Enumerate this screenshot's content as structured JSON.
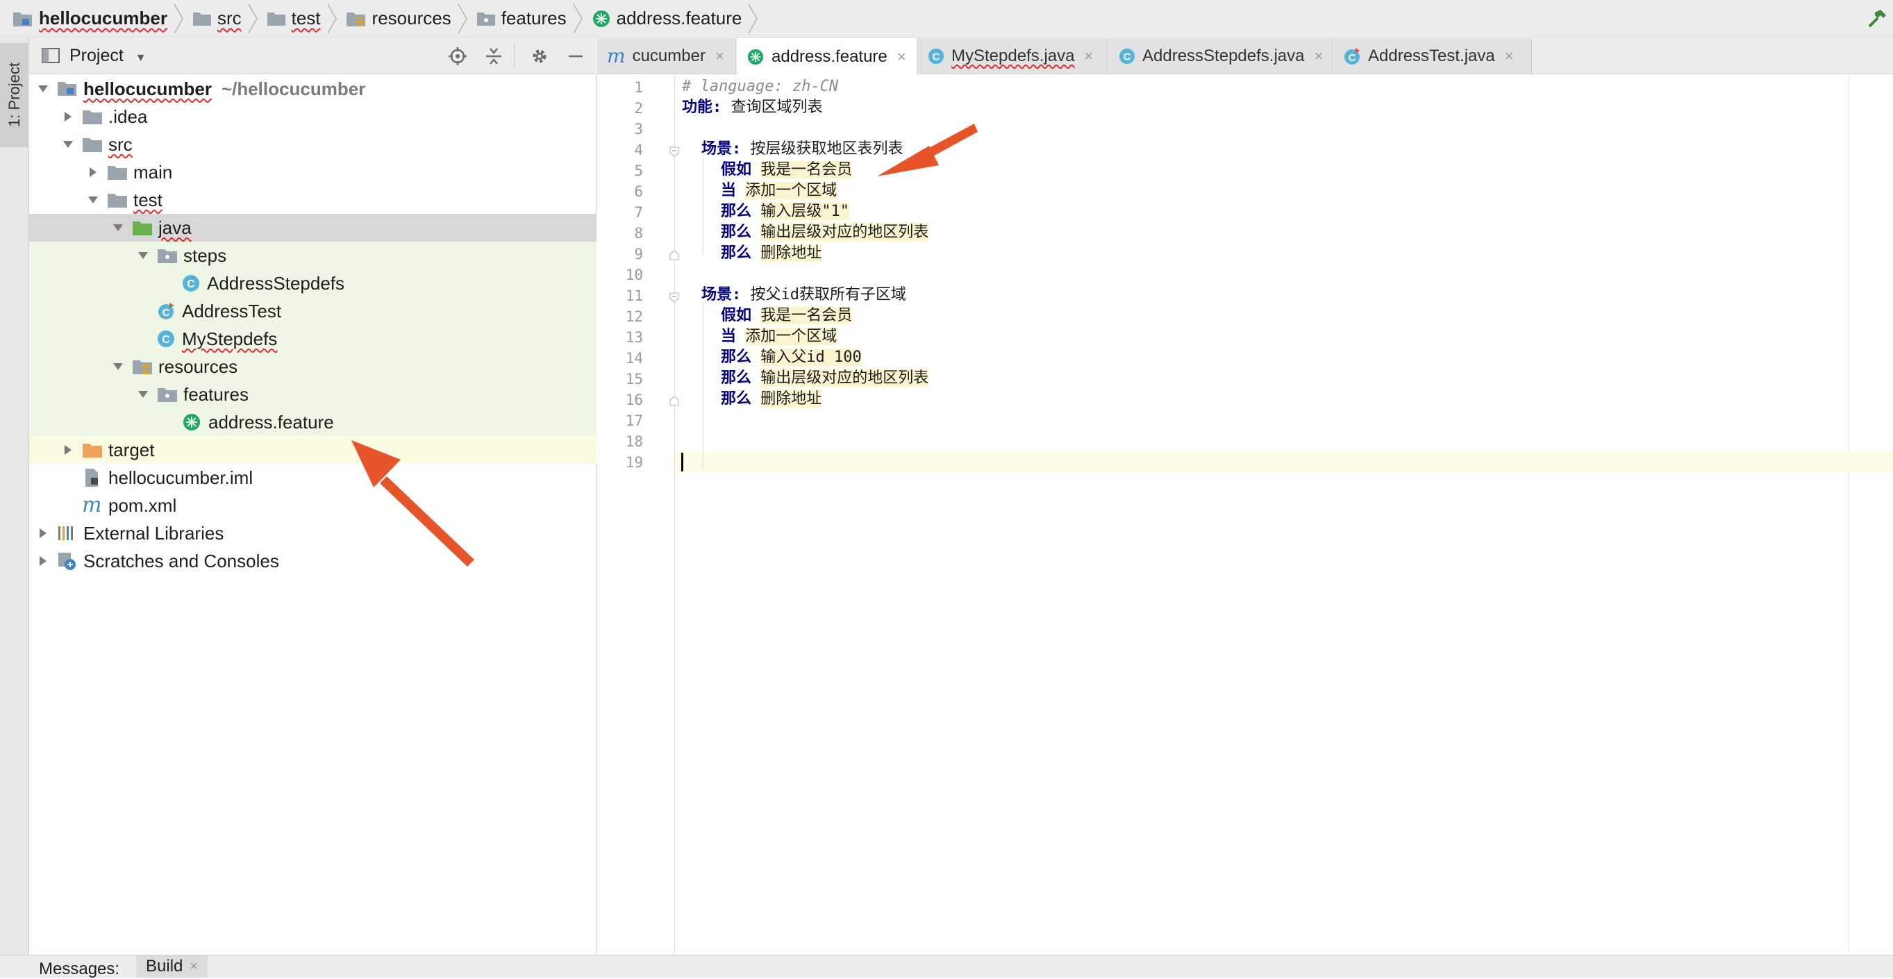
{
  "breadcrumb": [
    {
      "label": "hellocucumber",
      "icon": "module-folder-icon"
    },
    {
      "label": "src",
      "icon": "folder-icon"
    },
    {
      "label": "test",
      "icon": "folder-icon"
    },
    {
      "label": "resources",
      "icon": "resources-folder-icon"
    },
    {
      "label": "features",
      "icon": "package-folder-icon"
    },
    {
      "label": "address.feature",
      "icon": "cucumber-icon"
    }
  ],
  "build_icon": "hammer-icon",
  "tool_window": {
    "stripe_label": "1: Project",
    "title": "Project"
  },
  "project_tree": [
    {
      "label": "hellocucumber",
      "path": "~/hellocucumber",
      "icon": "module-folder-icon"
    },
    {
      "label": ".idea",
      "icon": "folder-icon"
    },
    {
      "label": "src",
      "icon": "folder-icon"
    },
    {
      "label": "main",
      "icon": "folder-icon"
    },
    {
      "label": "test",
      "icon": "folder-icon"
    },
    {
      "label": "java",
      "icon": "test-source-folder-icon"
    },
    {
      "label": "steps",
      "icon": "package-folder-icon"
    },
    {
      "label": "AddressStepdefs",
      "icon": "class-icon"
    },
    {
      "label": "AddressTest",
      "icon": "test-class-icon"
    },
    {
      "label": "MyStepdefs",
      "icon": "class-icon"
    },
    {
      "label": "resources",
      "icon": "resources-folder-icon"
    },
    {
      "label": "features",
      "icon": "package-folder-icon"
    },
    {
      "label": "address.feature",
      "icon": "cucumber-icon"
    },
    {
      "label": "target",
      "icon": "excluded-folder-icon"
    },
    {
      "label": "hellocucumber.iml",
      "icon": "iml-file-icon"
    },
    {
      "label": "pom.xml",
      "icon": "maven-icon"
    },
    {
      "label": "External Libraries",
      "icon": "libraries-icon"
    },
    {
      "label": "Scratches and Consoles",
      "icon": "scratches-icon"
    }
  ],
  "editor_tabs": [
    {
      "label": "cucumber",
      "icon": "maven-icon",
      "active": false
    },
    {
      "label": "address.feature",
      "icon": "cucumber-icon",
      "active": true
    },
    {
      "label": "MyStepdefs.java",
      "icon": "class-icon",
      "active": false
    },
    {
      "label": "AddressStepdefs.java",
      "icon": "class-icon",
      "active": false
    },
    {
      "label": "AddressTest.java",
      "icon": "test-class-icon",
      "active": false
    }
  ],
  "tab_close_glyph": "×",
  "line_numbers": [
    "1",
    "2",
    "3",
    "4",
    "5",
    "6",
    "7",
    "8",
    "9",
    "10",
    "11",
    "12",
    "13",
    "14",
    "15",
    "16",
    "17",
    "18",
    "19"
  ],
  "code": {
    "l1": "# language: zh-CN",
    "l2_kw": "功能:",
    "l2_text": " 查询区域列表",
    "l4_kw": "场景:",
    "l4_text": " 按层级获取地区表列表",
    "l5_kw": "假如",
    "l5_text": "我是一名会员",
    "l6_kw": "当",
    "l6_text": "添加一个区域",
    "l7_kw": "那么",
    "l7_text": "输入层级\"1\"",
    "l8_kw": "那么",
    "l8_text": "输出层级对应的地区列表",
    "l9_kw": "那么",
    "l9_text": "删除地址",
    "l11_kw": "场景:",
    "l11_text": " 按父id获取所有子区域",
    "l12_kw": "假如",
    "l12_text": "我是一名会员",
    "l13_kw": "当",
    "l13_text": "添加一个区域",
    "l14_kw": "那么",
    "l14_text": "输入父id 100",
    "l15_kw": "那么",
    "l15_text": "输出层级对应的地区列表",
    "l16_kw": "那么",
    "l16_text": "删除地址"
  },
  "bottom": {
    "messages_label": "Messages:",
    "build_tab": "Build"
  },
  "colors": {
    "accent_arrow": "#e8542a",
    "keyword": "#000080",
    "highlight": "#fcf3cf",
    "test_root_bg": "#eef7e6"
  }
}
